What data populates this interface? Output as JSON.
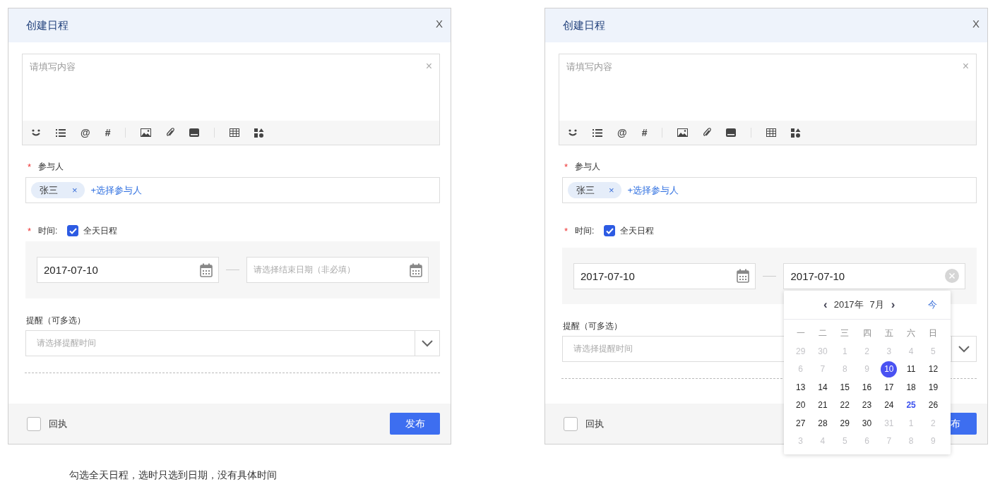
{
  "dialogs": [
    {
      "title": "创建日程",
      "close": "X",
      "editor": {
        "placeholder": "请填写内容",
        "clear": "×",
        "toolbar": [
          {
            "kind": "emoji"
          },
          {
            "kind": "list"
          },
          {
            "kind": "text",
            "label": "@"
          },
          {
            "kind": "text",
            "label": "#"
          },
          {
            "kind": "divider"
          },
          {
            "kind": "image"
          },
          {
            "kind": "attach"
          },
          {
            "kind": "drive"
          },
          {
            "kind": "divider"
          },
          {
            "kind": "table"
          },
          {
            "kind": "apps"
          }
        ]
      },
      "participants": {
        "label": "参与人",
        "required_mark": "*",
        "tags": [
          {
            "name": "张三",
            "remove": "×"
          }
        ],
        "add": "+选择参与人"
      },
      "time": {
        "label": "时间:",
        "required_mark": "*",
        "all_day": {
          "label": "全天日程",
          "checked": true
        },
        "start": {
          "value": "2017-07-10"
        },
        "end": {
          "placeholder": "请选择结束日期（非必填）"
        }
      },
      "remind": {
        "label": "提醒（可多选）",
        "placeholder": "请选择提醒时间"
      },
      "footer": {
        "receipt": {
          "label": "回执",
          "checked": false
        },
        "publish": "发布"
      }
    },
    {
      "title": "创建日程",
      "close": "X",
      "editor": {
        "placeholder": "请填写内容",
        "clear": "×",
        "toolbar": [
          {
            "kind": "emoji"
          },
          {
            "kind": "list"
          },
          {
            "kind": "text",
            "label": "@"
          },
          {
            "kind": "text",
            "label": "#"
          },
          {
            "kind": "divider"
          },
          {
            "kind": "image"
          },
          {
            "kind": "attach"
          },
          {
            "kind": "drive"
          },
          {
            "kind": "divider"
          },
          {
            "kind": "table"
          },
          {
            "kind": "apps"
          }
        ]
      },
      "participants": {
        "label": "参与人",
        "required_mark": "*",
        "tags": [
          {
            "name": "张三",
            "remove": "×"
          }
        ],
        "add": "+选择参与人"
      },
      "time": {
        "label": "时间:",
        "required_mark": "*",
        "all_day": {
          "label": "全天日程",
          "checked": true
        },
        "start": {
          "value": "2017-07-10"
        },
        "end": {
          "value": "2017-07-10"
        }
      },
      "remind": {
        "label": "提醒（可多选）",
        "placeholder": "请选择提醒时间"
      },
      "footer": {
        "receipt": {
          "label": "回执",
          "checked": false
        },
        "publish": "布"
      },
      "calendar": {
        "prev": "‹",
        "year": "2017年",
        "month": "7月",
        "next": "›",
        "today": "今",
        "weekdays": [
          "一",
          "二",
          "三",
          "四",
          "五",
          "六",
          "日"
        ],
        "weeks": [
          [
            {
              "day": "29",
              "kind": "other"
            },
            {
              "day": "30",
              "kind": "other"
            },
            {
              "day": "1",
              "kind": "disabled"
            },
            {
              "day": "2",
              "kind": "disabled"
            },
            {
              "day": "3",
              "kind": "disabled"
            },
            {
              "day": "4",
              "kind": "disabled"
            },
            {
              "day": "5",
              "kind": "disabled"
            }
          ],
          [
            {
              "day": "6",
              "kind": "disabled"
            },
            {
              "day": "7",
              "kind": "disabled"
            },
            {
              "day": "8",
              "kind": "disabled"
            },
            {
              "day": "9",
              "kind": "disabled"
            },
            {
              "day": "10",
              "kind": "selected"
            },
            {
              "day": "11",
              "kind": "normal"
            },
            {
              "day": "12",
              "kind": "normal"
            }
          ],
          [
            {
              "day": "13",
              "kind": "normal"
            },
            {
              "day": "14",
              "kind": "normal"
            },
            {
              "day": "15",
              "kind": "normal"
            },
            {
              "day": "16",
              "kind": "normal"
            },
            {
              "day": "17",
              "kind": "normal"
            },
            {
              "day": "18",
              "kind": "normal"
            },
            {
              "day": "19",
              "kind": "normal"
            }
          ],
          [
            {
              "day": "20",
              "kind": "normal"
            },
            {
              "day": "21",
              "kind": "normal"
            },
            {
              "day": "22",
              "kind": "normal"
            },
            {
              "day": "23",
              "kind": "normal"
            },
            {
              "day": "24",
              "kind": "normal"
            },
            {
              "day": "25",
              "kind": "today"
            },
            {
              "day": "26",
              "kind": "normal"
            }
          ],
          [
            {
              "day": "27",
              "kind": "normal"
            },
            {
              "day": "28",
              "kind": "normal"
            },
            {
              "day": "29",
              "kind": "normal"
            },
            {
              "day": "30",
              "kind": "normal"
            },
            {
              "day": "31",
              "kind": "other"
            },
            {
              "day": "1",
              "kind": "other"
            },
            {
              "day": "2",
              "kind": "other"
            }
          ],
          [
            {
              "day": "3",
              "kind": "other"
            },
            {
              "day": "4",
              "kind": "other"
            },
            {
              "day": "5",
              "kind": "other"
            },
            {
              "day": "6",
              "kind": "other"
            },
            {
              "day": "7",
              "kind": "other"
            },
            {
              "day": "8",
              "kind": "other"
            },
            {
              "day": "9",
              "kind": "other"
            }
          ]
        ]
      }
    }
  ],
  "caption": "勾选全天日程，选时只选到日期，没有具体时间"
}
